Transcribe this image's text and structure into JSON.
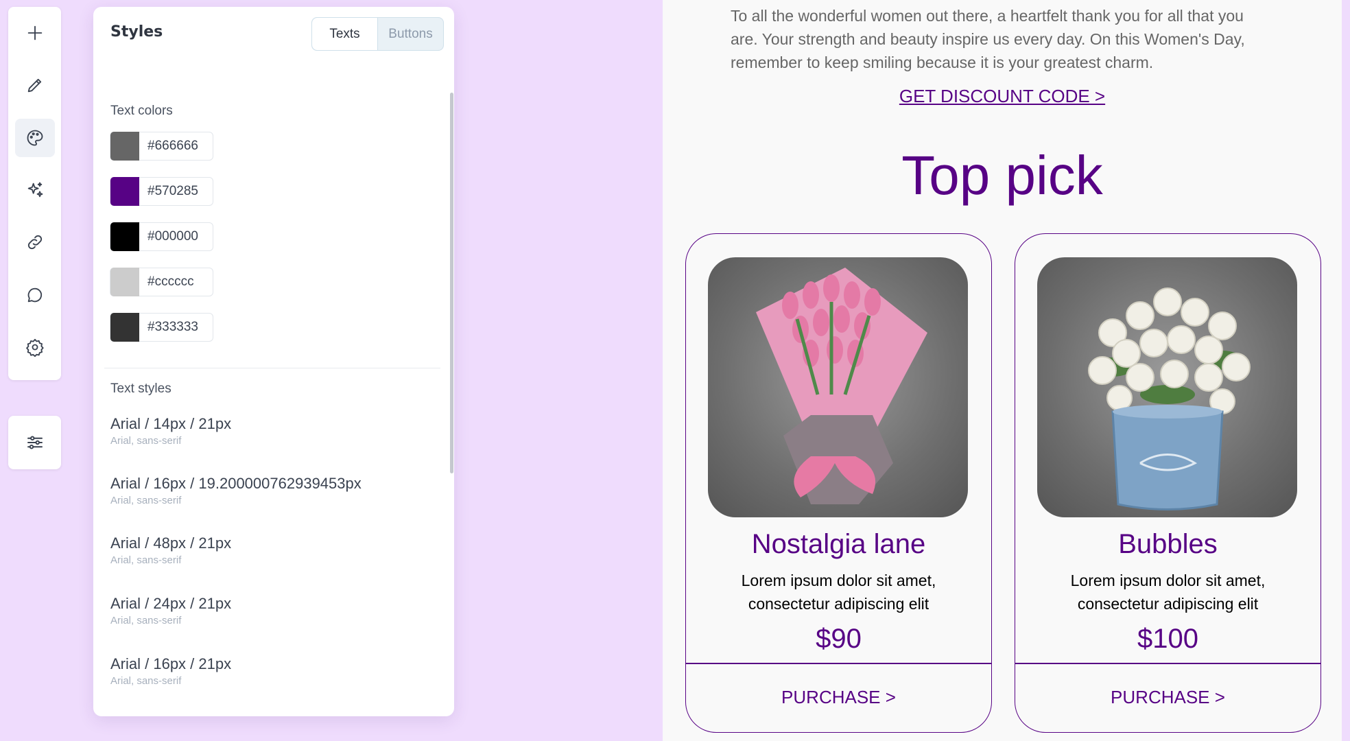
{
  "toolbar": {
    "items": [
      {
        "icon": "plus-icon"
      },
      {
        "icon": "pencil-icon"
      },
      {
        "icon": "palette-icon",
        "active": true
      },
      {
        "icon": "sparkles-icon"
      },
      {
        "icon": "link-icon"
      },
      {
        "icon": "comment-icon"
      },
      {
        "icon": "gear-icon"
      }
    ],
    "bottom_icon": "sliders-icon"
  },
  "styles_panel": {
    "title": "Styles",
    "tabs": [
      {
        "label": "Texts",
        "active": true
      },
      {
        "label": "Buttons",
        "active": false
      }
    ],
    "text_colors_label": "Text colors",
    "text_colors": [
      {
        "hex": "#666666",
        "label": "#666666"
      },
      {
        "hex": "#570285",
        "label": "#570285"
      },
      {
        "hex": "#000000",
        "label": "#000000"
      },
      {
        "hex": "#cccccc",
        "label": "#cccccc"
      },
      {
        "hex": "#333333",
        "label": "#333333"
      }
    ],
    "text_styles_label": "Text styles",
    "text_styles": [
      {
        "main": "Arial / 14px / 21px",
        "sub": "Arial, sans-serif"
      },
      {
        "main": "Arial / 16px / 19.200000762939453px",
        "sub": "Arial, sans-serif"
      },
      {
        "main": "Arial / 48px / 21px",
        "sub": "Arial, sans-serif"
      },
      {
        "main": "Arial / 24px / 21px",
        "sub": "Arial, sans-serif"
      },
      {
        "main": "Arial / 16px / 21px",
        "sub": "Arial, sans-serif"
      }
    ]
  },
  "email": {
    "intro": "To all the wonderful women out there, a heartfelt thank you for all that you are. Your strength and beauty inspire us every day. On this Women's Day, remember to keep smiling because it is your greatest charm.",
    "discount_link": "GET DISCOUNT CODE >",
    "heading": "Top pick",
    "products": [
      {
        "name": "Nostalgia lane",
        "desc": "Lorem ipsum dolor sit amet, consectetur adipiscing elit",
        "price": "$90",
        "button": "PURCHASE >",
        "image": "pink-tulip-bouquet"
      },
      {
        "name": "Bubbles",
        "desc": "Lorem ipsum dolor sit amet, consectetur adipiscing elit",
        "price": "$100",
        "button": "PURCHASE >",
        "image": "white-roses-in-blue-pot"
      }
    ],
    "accent_color": "#570285"
  }
}
